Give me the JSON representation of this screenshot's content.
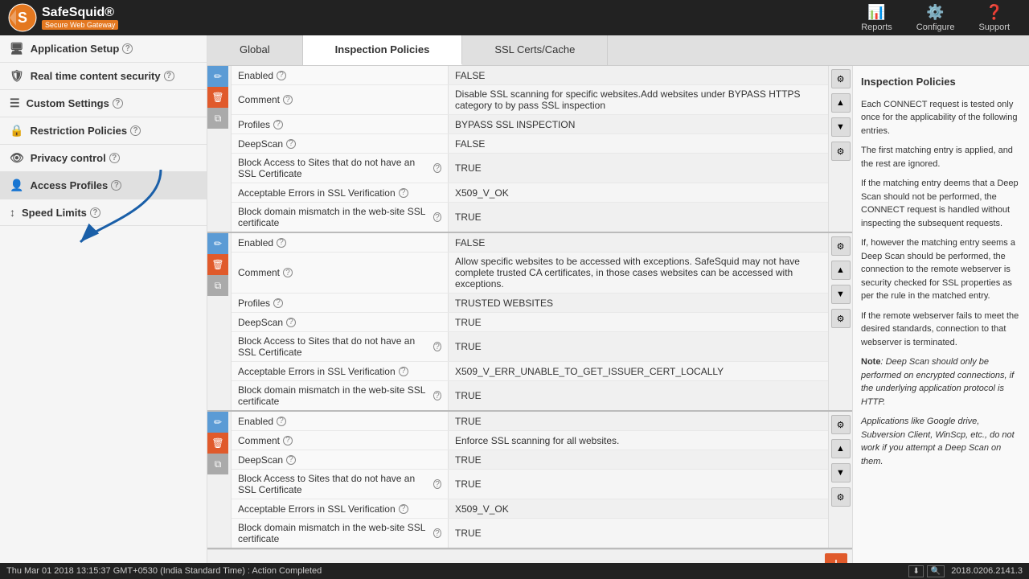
{
  "header": {
    "logo_title": "SafeSquid®",
    "logo_subtitle": "Secure Web Gateway",
    "nav_items": [
      {
        "label": "Reports",
        "icon": "📊"
      },
      {
        "label": "Configure",
        "icon": "⚙️"
      },
      {
        "label": "Support",
        "icon": "❓"
      }
    ]
  },
  "sidebar": {
    "items": [
      {
        "label": "Application Setup",
        "icon": "🖥",
        "has_help": true
      },
      {
        "label": "Real time content security",
        "icon": "🛡",
        "has_help": true
      },
      {
        "label": "Custom Settings",
        "icon": "☰",
        "has_help": true
      },
      {
        "label": "Restriction Policies",
        "icon": "🔒",
        "has_help": true
      },
      {
        "label": "Privacy control",
        "icon": "👁",
        "has_help": true
      },
      {
        "label": "Access Profiles",
        "icon": "👤",
        "has_help": true
      },
      {
        "label": "Speed Limits",
        "icon": "↕",
        "has_help": true
      }
    ]
  },
  "tabs": [
    {
      "label": "Global",
      "active": false
    },
    {
      "label": "Inspection Policies",
      "active": true
    },
    {
      "label": "SSL Certs/Cache",
      "active": false
    }
  ],
  "entries": [
    {
      "id": 1,
      "rows": [
        {
          "label": "Enabled",
          "has_help": true,
          "value": "FALSE"
        },
        {
          "label": "Comment",
          "has_help": true,
          "value": "Disable SSL scanning for specific websites.Add websites under BYPASS HTTPS category to by pass SSL inspection"
        },
        {
          "label": "Profiles",
          "has_help": true,
          "value": "BYPASS SSL INSPECTION"
        },
        {
          "label": "DeepScan",
          "has_help": true,
          "value": "FALSE"
        },
        {
          "label": "Block Access to Sites that do not have an SSL Certificate",
          "has_help": true,
          "value": "TRUE"
        },
        {
          "label": "Acceptable Errors in SSL Verification",
          "has_help": true,
          "value": "X509_V_OK"
        },
        {
          "label": "Block domain mismatch in the web-site SSL certificate",
          "has_help": true,
          "value": "TRUE"
        }
      ]
    },
    {
      "id": 2,
      "rows": [
        {
          "label": "Enabled",
          "has_help": true,
          "value": "FALSE"
        },
        {
          "label": "Comment",
          "has_help": true,
          "value": "Allow specific websites to be accessed with exceptions. SafeSquid may not have complete trusted CA certificates, in those cases websites can be accessed with exceptions."
        },
        {
          "label": "Profiles",
          "has_help": true,
          "value": "TRUSTED WEBSITES"
        },
        {
          "label": "DeepScan",
          "has_help": true,
          "value": "TRUE"
        },
        {
          "label": "Block Access to Sites that do not have an SSL Certificate",
          "has_help": true,
          "value": "TRUE"
        },
        {
          "label": "Acceptable Errors in SSL Verification",
          "has_help": true,
          "value": "X509_V_ERR_UNABLE_TO_GET_ISSUER_CERT_LOCALLY"
        },
        {
          "label": "Block domain mismatch in the web-site SSL certificate",
          "has_help": true,
          "value": "TRUE"
        }
      ]
    },
    {
      "id": 3,
      "rows": [
        {
          "label": "Enabled",
          "has_help": true,
          "value": "TRUE"
        },
        {
          "label": "Comment",
          "has_help": true,
          "value": "Enforce SSL scanning for all websites."
        },
        {
          "label": "DeepScan",
          "has_help": true,
          "value": "TRUE"
        },
        {
          "label": "Block Access to Sites that do not have an SSL Certificate",
          "has_help": true,
          "value": "TRUE"
        },
        {
          "label": "Acceptable Errors in SSL Verification",
          "has_help": true,
          "value": "X509_V_OK"
        },
        {
          "label": "Block domain mismatch in the web-site SSL certificate",
          "has_help": true,
          "value": "TRUE"
        }
      ]
    }
  ],
  "side_panel": {
    "title": "Inspection Policies",
    "paragraphs": [
      "Each CONNECT request is tested only once for the applicability of the following entries.",
      "The first matching entry is applied, and the rest are ignored.",
      "If the matching entry deems that a Deep Scan should not be performed, the CONNECT request is handled without inspecting the subsequent requests.",
      "If, however the matching entry seems a Deep Scan should be performed, the connection to the remote webserver is security checked for SSL properties as per the rule in the matched entry.",
      "If the remote webserver fails to meet the desired standards, connection to that webserver is terminated."
    ],
    "note": "Deep Scan should only be performed on encrypted connections, if the underlying application protocol is HTTP.",
    "note2": "Applications like Google drive, Subversion Client, WinScp, etc., do not work if you attempt a Deep Scan on them."
  },
  "add_button_label": "+",
  "status": {
    "text": "Thu Mar 01 2018 13:15:37 GMT+0530 (India Standard Time) : Action Completed",
    "ip": "2018.0206.2141.3"
  }
}
